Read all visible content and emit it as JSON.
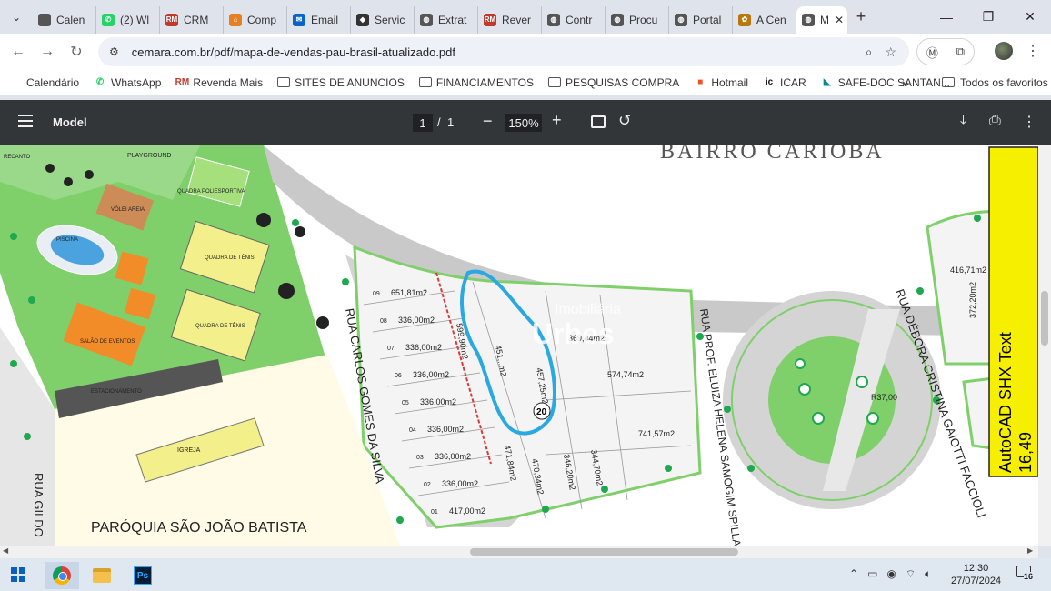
{
  "browser": {
    "tabs": [
      {
        "title": "Calen",
        "icon": "apple-icon",
        "color": "#555555",
        "glyph": ""
      },
      {
        "title": "(2) Wl",
        "icon": "whatsapp-icon",
        "color": "#25d366",
        "glyph": "✆"
      },
      {
        "title": "CRM",
        "icon": "rm-icon",
        "color": "#c0392b",
        "glyph": "RM"
      },
      {
        "title": "Comp",
        "icon": "store-icon",
        "color": "#e67e22",
        "glyph": "⌂"
      },
      {
        "title": "Email",
        "icon": "outlook-icon",
        "color": "#0a64c8",
        "glyph": "✉"
      },
      {
        "title": "Servic",
        "icon": "diamond-icon",
        "color": "#333333",
        "glyph": "◆"
      },
      {
        "title": "Extrat",
        "icon": "globe-icon",
        "color": "#555555",
        "glyph": "◍"
      },
      {
        "title": "Rever",
        "icon": "rm-icon",
        "color": "#c0392b",
        "glyph": "RM"
      },
      {
        "title": "Contr",
        "icon": "globe-icon",
        "color": "#555555",
        "glyph": "◍"
      },
      {
        "title": "Procu",
        "icon": "globe-icon",
        "color": "#555555",
        "glyph": "◍"
      },
      {
        "title": "Portal",
        "icon": "globe-icon",
        "color": "#555555",
        "glyph": "◍"
      },
      {
        "title": "A Cen",
        "icon": "flower-icon",
        "color": "#b9770e",
        "glyph": "✿"
      }
    ],
    "active_tab": {
      "title": "M",
      "close": "✕"
    },
    "new_tab": "+",
    "window_controls": {
      "minimize": "—",
      "maximize": "❐",
      "close": "✕"
    },
    "url": "cemara.com.br/pdf/mapa-de-vendas-pau-brasil-atualizado.pdf",
    "bookmarks": [
      {
        "label": "Calendário",
        "icon": "apple-icon"
      },
      {
        "label": "WhatsApp",
        "icon": "whatsapp-icon"
      },
      {
        "label": "Revenda Mais",
        "icon": "rm-icon"
      },
      {
        "label": "SITES DE ANUNCIOS",
        "icon": "folder-icon"
      },
      {
        "label": "FINANCIAMENTOS",
        "icon": "folder-icon"
      },
      {
        "label": "PESQUISAS COMPRA",
        "icon": "folder-icon"
      },
      {
        "label": "Hotmail",
        "icon": "microsoft-icon"
      },
      {
        "label": "ICAR",
        "icon": "icar-icon"
      },
      {
        "label": "SAFE-DOC SANTAN...",
        "icon": "safedoc-icon"
      }
    ],
    "bookmarks_more": "»",
    "all_bookmarks": "Todos os favoritos"
  },
  "pdf_toolbar": {
    "title": "Model",
    "page_current": "1",
    "page_sep": "/",
    "page_total": "1",
    "zoom": "150%"
  },
  "map": {
    "street_labels": [
      "BAIRRO CARIOBA",
      "RUA CARLOS GOMES DA SILVA",
      "RUA PROF. ELUIZA HELENA SAMOGIM SPILLA",
      "RUA DÉBORA CRISTINA GAIOTTI FACCIOLI",
      "RUA GILDO"
    ],
    "places": [
      "PLAYGROUND",
      "QUADRA POLIESPORTIVA",
      "VÔLEI AREIA",
      "PISCINA",
      "QUADRA DE TÊNIS",
      "QUADRA DE TÊNIS",
      "SALÃO DE EVENTOS",
      "ESTACIONAMENTO",
      "IGREJA",
      "PARÓQUIA SÃO JOÃO BATISTA",
      "RECANTO"
    ],
    "lots": [
      {
        "area": "651,81m2",
        "num": "09"
      },
      {
        "area": "336,00m2",
        "num": "08"
      },
      {
        "area": "336,00m2",
        "num": "07"
      },
      {
        "area": "336,00m2",
        "num": "06"
      },
      {
        "area": "336,00m2",
        "num": "05"
      },
      {
        "area": "336,00m2",
        "num": "04"
      },
      {
        "area": "336,00m2",
        "num": "03"
      },
      {
        "area": "336,00m2",
        "num": "02"
      },
      {
        "area": "417,00m2",
        "num": "01"
      }
    ],
    "other_areas": [
      "599,90m2",
      "451,..m2",
      "457,25m2",
      "369,44m2",
      "574,74m2",
      "471,84m2",
      "470,34m2",
      "346,20m2",
      "344,70m2",
      "741,57m2",
      "416,71m2",
      "372,20m2",
      "R37,00"
    ],
    "highlight_lot": "20",
    "watermark": {
      "line1": "Imobiliária",
      "line2": "Urbes"
    },
    "cad_label": {
      "line1": "AutoCAD SHX Text",
      "line2": "16,49"
    }
  },
  "taskbar": {
    "time": "12:30",
    "date": "27/07/2024",
    "notifications": "16"
  }
}
